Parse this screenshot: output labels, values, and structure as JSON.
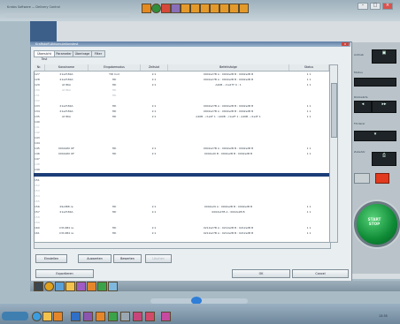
{
  "window": {
    "title": "Kratos Software — Delivery Control"
  },
  "dialog": {
    "title": "Kraftstoff-Akkumulationstest",
    "close_label": "x",
    "tabs": [
      "Übersicht Test",
      "Parameter",
      "Übertrage",
      "Filter"
    ],
    "columns": [
      "Nr.",
      "Kanalname",
      "Eingabemodus",
      "Zeitslot",
      "Befehlsfolge",
      "Status"
    ],
    "rows": [
      {
        "nr": "127",
        "name": "21s2f-8KA",
        "mode": "TID Cod",
        "time": "2:1",
        "cmd": "0002s27B A : 0002s2B B : 0002s2B B",
        "stat": "1 1",
        "style": "normal"
      },
      {
        "nr": "128",
        "name": "21s2f-8KA",
        "mode": "HD",
        "time": "2:1",
        "cmd": "0002s27B A : 0002s2B B : 0002s2B B",
        "stat": "1 1",
        "style": "normal"
      },
      {
        "nr": "129",
        "name": "At 8KA",
        "mode": "HD",
        "time": "2:1",
        "cmd": "A40B - c1s27F 0 : 1",
        "stat": "1 1",
        "style": "normal"
      },
      {
        "nr": "130",
        "name": "At 8KA",
        "mode": "HD",
        "time": "",
        "cmd": "",
        "stat": "",
        "style": "faded"
      },
      {
        "nr": "131",
        "name": "",
        "mode": "HD",
        "time": "",
        "cmd": "",
        "stat": "",
        "style": "faded"
      },
      {
        "nr": "132",
        "name": "",
        "mode": "",
        "time": "",
        "cmd": "",
        "stat": "",
        "style": "faded"
      },
      {
        "nr": "133",
        "name": "21s2f-8KA",
        "mode": "HD",
        "time": "2:1",
        "cmd": "0002s27B A : 0002s2B B : 0002s2B B",
        "stat": "1 1",
        "style": "normal"
      },
      {
        "nr": "134",
        "name": "21s2f-8KA",
        "mode": "HD",
        "time": "2:1",
        "cmd": "0002s27B A : 0002s2B B : 0002s2B B",
        "stat": "1 1",
        "style": "normal"
      },
      {
        "nr": "135",
        "name": "At 8KA",
        "mode": "HD",
        "time": "2:1",
        "cmd": "A40B - c1s2F 1 : A40B - c1s2F 1 : A40B - c1s2F 1",
        "stat": "1 1",
        "style": "normal"
      },
      {
        "nr": "140",
        "name": "",
        "mode": "",
        "time": "",
        "cmd": "",
        "stat": "",
        "style": "normal"
      },
      {
        "nr": "141",
        "name": "",
        "mode": "",
        "time": "",
        "cmd": "",
        "stat": "",
        "style": "faded"
      },
      {
        "nr": "142",
        "name": "",
        "mode": "",
        "time": "",
        "cmd": "",
        "stat": "",
        "style": "faded"
      },
      {
        "nr": "143",
        "name": "",
        "mode": "",
        "time": "",
        "cmd": "",
        "stat": "",
        "style": "normal"
      },
      {
        "nr": "144",
        "name": "",
        "mode": "",
        "time": "",
        "cmd": "",
        "stat": "",
        "style": "normal"
      },
      {
        "nr": "145",
        "name": "0002s80 OF",
        "mode": "HD",
        "time": "2:1",
        "cmd": "0002s27B A : 0002s2B B : 0002s2B B",
        "stat": "1 1",
        "style": "normal"
      },
      {
        "nr": "146",
        "name": "0002s80 OF",
        "mode": "HD",
        "time": "2:1",
        "cmd": "0002s40 B : 0002s2B B : 0002s2B B",
        "stat": "1 1",
        "style": "normal"
      },
      {
        "nr": "147",
        "name": "",
        "mode": "",
        "time": "",
        "cmd": "",
        "stat": "",
        "style": "normal"
      },
      {
        "nr": "148",
        "name": "",
        "mode": "",
        "time": "",
        "cmd": "",
        "stat": "",
        "style": "faded"
      },
      {
        "nr": "149",
        "name": "",
        "mode": "",
        "time": "",
        "cmd": "",
        "stat": "",
        "style": "normal"
      },
      {
        "nr": "150",
        "name": "",
        "mode": "",
        "time": "",
        "cmd": "",
        "stat": "",
        "style": "sel"
      },
      {
        "nr": "151",
        "name": "",
        "mode": "",
        "time": "",
        "cmd": "",
        "stat": "",
        "style": "normal"
      },
      {
        "nr": "152",
        "name": "",
        "mode": "",
        "time": "",
        "cmd": "",
        "stat": "",
        "style": "faded"
      },
      {
        "nr": "153",
        "name": "",
        "mode": "",
        "time": "",
        "cmd": "",
        "stat": "",
        "style": "faded"
      },
      {
        "nr": "154",
        "name": "",
        "mode": "",
        "time": "",
        "cmd": "",
        "stat": "",
        "style": "faded"
      },
      {
        "nr": "155",
        "name": "",
        "mode": "",
        "time": "",
        "cmd": "",
        "stat": "",
        "style": "faded"
      },
      {
        "nr": "156",
        "name": "29s3B8 re",
        "mode": "HD",
        "time": "2:1",
        "cmd": "0002s29 A : 0002s2B B : 0002s2B B",
        "stat": "1 1",
        "style": "normal"
      },
      {
        "nr": "157",
        "name": "21s2f-8KA",
        "mode": "HD",
        "time": "2:1",
        "cmd": "0002s27B A : 0002s2B B",
        "stat": "1 1",
        "style": "normal"
      },
      {
        "nr": "158",
        "name": "",
        "mode": "",
        "time": "",
        "cmd": "",
        "stat": "",
        "style": "faded"
      },
      {
        "nr": "159",
        "name": "",
        "mode": "",
        "time": "",
        "cmd": "",
        "stat": "",
        "style": "faded"
      },
      {
        "nr": "160",
        "name": "C3t-0B4 re",
        "mode": "HD",
        "time": "2:1",
        "cmd": "0212s27B A : 0212s2B B : 0212s2B B",
        "stat": "1 1",
        "style": "normal"
      },
      {
        "nr": "161",
        "name": "C3t-0B4 re",
        "mode": "HD",
        "time": "2:1",
        "cmd": "0212s27B A : 0212s2B B : 0212s2B B",
        "stat": "1 1",
        "style": "normal"
      }
    ],
    "buttons": {
      "new": "Einstellen",
      "detail": "Auswerten",
      "edit": "Bewerten",
      "delete": "Löschen",
      "save": "Exportieren",
      "ok": "OK",
      "cancel": "Cancel"
    }
  },
  "right_panel": {
    "start_label": "START\nSTOP",
    "labels": [
      "Antrieb",
      "Modus",
      "Rückwärts",
      "Förderer",
      "Zubehör"
    ]
  },
  "taskbar": {
    "clock": "13:35"
  },
  "colors": {
    "selection": "#1b3d78",
    "start_button": "#0e8a35",
    "title_blue": "#5f7fa6"
  }
}
